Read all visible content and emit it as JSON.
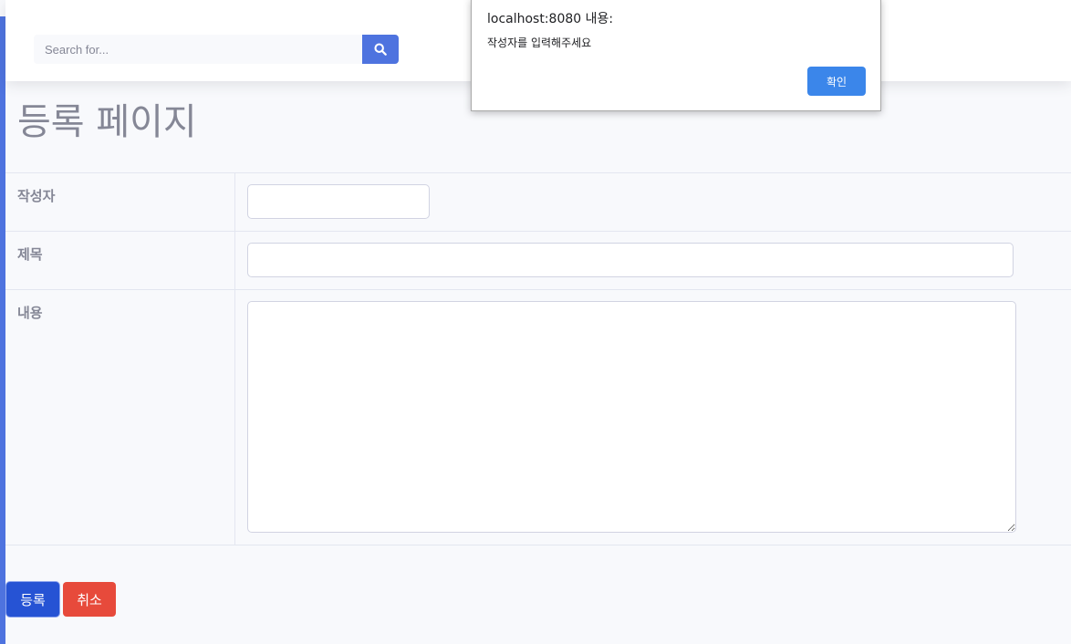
{
  "topbar": {
    "search": {
      "placeholder": "Search for...",
      "value": ""
    },
    "search_button_icon": "search-icon"
  },
  "page": {
    "title": "등록 페이지"
  },
  "form": {
    "author": {
      "label": "작성자",
      "value": ""
    },
    "title": {
      "label": "제목",
      "value": ""
    },
    "content": {
      "label": "내용",
      "value": ""
    }
  },
  "actions": {
    "submit_label": "등록",
    "cancel_label": "취소"
  },
  "dialog": {
    "origin": "localhost:8080 내용:",
    "message": "작성자를 입력해주세요",
    "ok_label": "확인"
  },
  "colors": {
    "primary": "#4e73df",
    "submit": "#2653d4",
    "danger": "#e74a3b",
    "dialog_button": "#3b86ea",
    "text_muted": "#858796",
    "background": "#f8f9fc"
  }
}
